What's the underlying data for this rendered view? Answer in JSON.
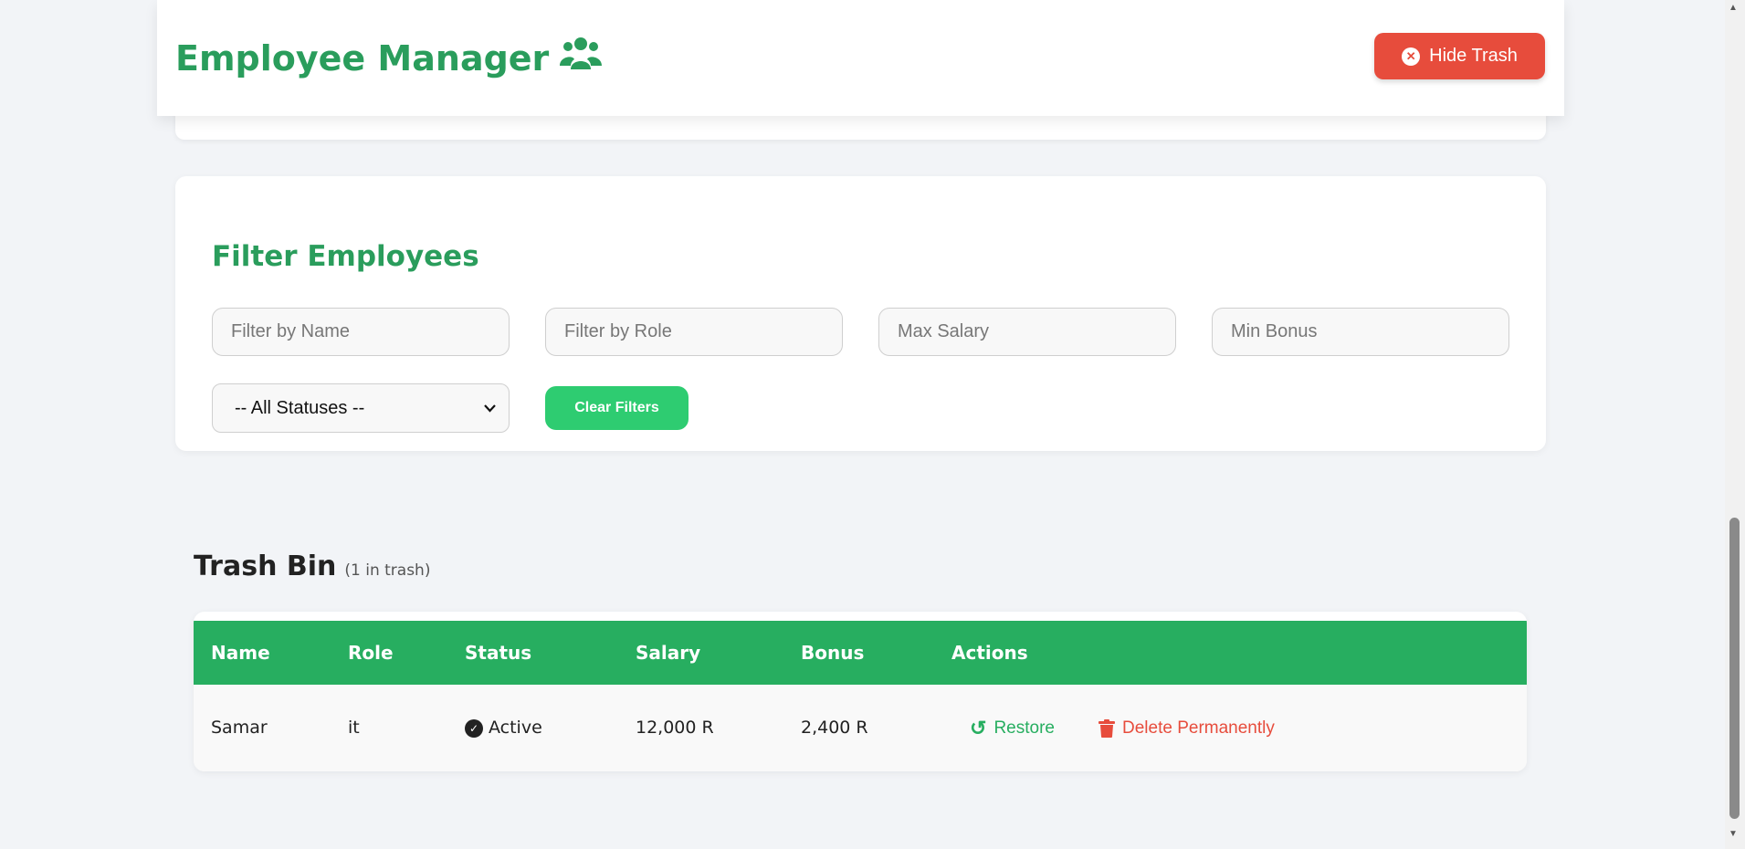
{
  "header": {
    "title": "Employee Manager",
    "title_icon": "users-icon",
    "hide_trash_label": "Hide Trash",
    "hide_trash_icon": "close-circle-icon"
  },
  "filters": {
    "title": "Filter Employees",
    "name_placeholder": "Filter by Name",
    "role_placeholder": "Filter by Role",
    "max_salary_placeholder": "Max Salary",
    "min_bonus_placeholder": "Min Bonus",
    "status_selected": "-- All Statuses --",
    "clear_label": "Clear Filters"
  },
  "trash": {
    "title": "Trash Bin",
    "count_text": "(1 in trash)",
    "columns": [
      "Name",
      "Role",
      "Status",
      "Salary",
      "Bonus",
      "Actions"
    ],
    "rows": [
      {
        "name": "Samar",
        "role": "it",
        "status": "Active",
        "salary": "12,000 R",
        "bonus": "2,400 R",
        "restore_label": "Restore",
        "delete_label": "Delete Permanently"
      }
    ]
  },
  "colors": {
    "primary_green": "#27ae60",
    "accent_green": "#2ecc71",
    "danger_red": "#e74c3c",
    "background": "#f2f4f7"
  }
}
